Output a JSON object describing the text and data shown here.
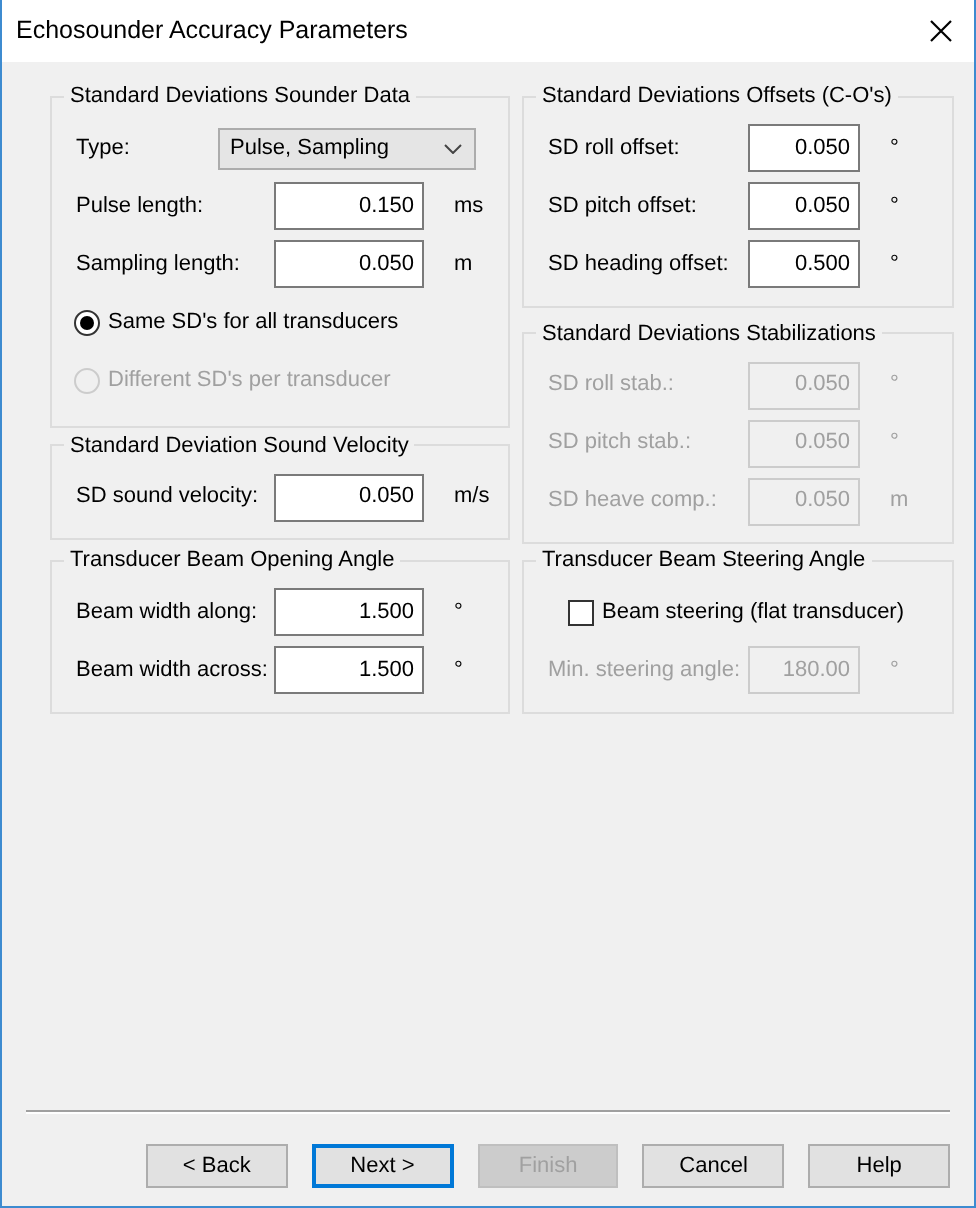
{
  "window": {
    "title": "Echosounder Accuracy Parameters"
  },
  "left_groups": [
    {
      "title": "Standard Deviations Sounder Data",
      "fields": [
        {
          "kind": "select",
          "label": "Type:",
          "value": "Pulse, Sampling",
          "disabled": false
        },
        {
          "kind": "number",
          "label": "Pulse length:",
          "value": "0.150",
          "unit": "ms",
          "disabled": false
        },
        {
          "kind": "number",
          "label": "Sampling length:",
          "value": "0.050",
          "unit": "m",
          "disabled": false
        },
        {
          "kind": "radio",
          "label": "Same SD's for all transducers",
          "selected": true,
          "disabled": false
        },
        {
          "kind": "radio",
          "label": "Different SD's per transducer",
          "selected": false,
          "disabled": true
        }
      ]
    },
    {
      "title": "Standard Deviation Sound Velocity",
      "fields": [
        {
          "kind": "number",
          "label": "SD sound velocity:",
          "value": "0.050",
          "unit": "m/s",
          "disabled": false
        }
      ]
    }
  ],
  "right_groups": [
    {
      "title": "Standard Deviations Offsets (C-O's)",
      "fields": [
        {
          "kind": "number",
          "label": "SD roll offset:",
          "value": "0.050",
          "unit": "°",
          "disabled": false
        },
        {
          "kind": "number",
          "label": "SD pitch offset:",
          "value": "0.050",
          "unit": "°",
          "disabled": false
        },
        {
          "kind": "number",
          "label": "SD heading offset:",
          "value": "0.500",
          "unit": "°",
          "disabled": false
        }
      ]
    },
    {
      "title": "Standard Deviations Stabilizations",
      "fields": [
        {
          "kind": "number",
          "label": "SD roll stab.:",
          "value": "0.050",
          "unit": "°",
          "disabled": true
        },
        {
          "kind": "number",
          "label": "SD pitch stab.:",
          "value": "0.050",
          "unit": "°",
          "disabled": true
        },
        {
          "kind": "number",
          "label": "SD heave comp.:",
          "value": "0.050",
          "unit": "m",
          "disabled": true
        }
      ]
    }
  ],
  "bottom_groups": [
    {
      "title": "Transducer Beam Opening Angle",
      "fields": [
        {
          "kind": "number",
          "label": "Beam width along:",
          "value": "1.500",
          "unit": "°",
          "disabled": false
        },
        {
          "kind": "number",
          "label": "Beam width across:",
          "value": "1.500",
          "unit": "°",
          "disabled": false
        }
      ]
    },
    {
      "title": "Transducer Beam Steering Angle",
      "fields": [
        {
          "kind": "checkbox",
          "label": "Beam steering (flat transducer)",
          "checked": false,
          "disabled": false
        },
        {
          "kind": "number",
          "label": "Min. steering angle:",
          "value": "180.00",
          "unit": "°",
          "disabled": true
        }
      ]
    }
  ],
  "buttons": [
    {
      "label": "< Back",
      "default": false,
      "disabled": false
    },
    {
      "label": "Next >",
      "default": true,
      "disabled": false
    },
    {
      "label": "Finish",
      "default": false,
      "disabled": true
    },
    {
      "label": "Cancel",
      "default": false,
      "disabled": false
    },
    {
      "label": "Help",
      "default": false,
      "disabled": false
    }
  ]
}
